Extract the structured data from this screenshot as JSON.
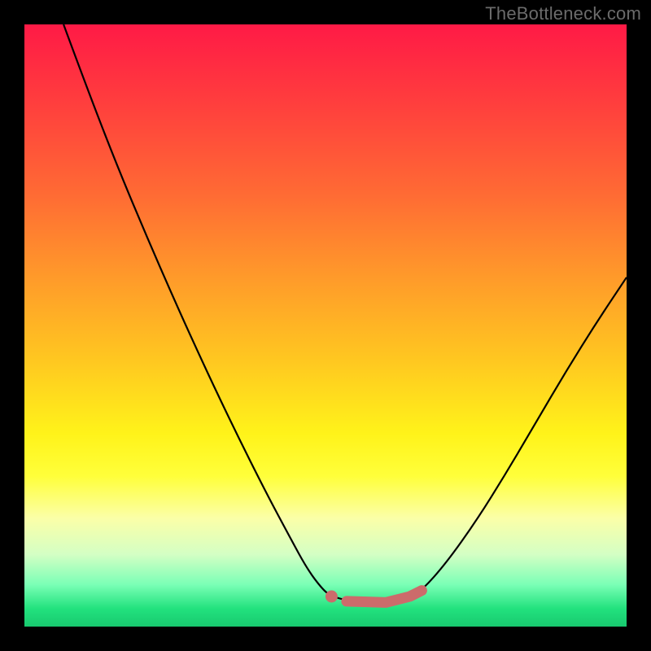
{
  "watermark": "TheBottleneck.com",
  "chart_data": {
    "type": "line",
    "title": "",
    "xlabel": "",
    "ylabel": "",
    "xlim": [
      0,
      1
    ],
    "ylim": [
      0,
      1
    ],
    "background_gradient": {
      "orientation": "vertical",
      "stops": [
        {
          "pos": 0.0,
          "color": "#ff1a46"
        },
        {
          "pos": 0.12,
          "color": "#ff3b3e"
        },
        {
          "pos": 0.28,
          "color": "#ff6a34"
        },
        {
          "pos": 0.42,
          "color": "#ff9a2a"
        },
        {
          "pos": 0.56,
          "color": "#ffc820"
        },
        {
          "pos": 0.68,
          "color": "#fff31a"
        },
        {
          "pos": 0.75,
          "color": "#ffff3a"
        },
        {
          "pos": 0.82,
          "color": "#fbffa8"
        },
        {
          "pos": 0.88,
          "color": "#d4ffc4"
        },
        {
          "pos": 0.93,
          "color": "#7bffb6"
        },
        {
          "pos": 0.97,
          "color": "#22e27e"
        },
        {
          "pos": 1.0,
          "color": "#18c96f"
        }
      ]
    },
    "series": [
      {
        "name": "curve",
        "color": "#000000",
        "points": [
          {
            "x": 0.065,
            "y": 1.0
          },
          {
            "x": 0.1,
            "y": 0.905
          },
          {
            "x": 0.15,
            "y": 0.775
          },
          {
            "x": 0.2,
            "y": 0.655
          },
          {
            "x": 0.25,
            "y": 0.54
          },
          {
            "x": 0.3,
            "y": 0.43
          },
          {
            "x": 0.35,
            "y": 0.325
          },
          {
            "x": 0.4,
            "y": 0.225
          },
          {
            "x": 0.44,
            "y": 0.15
          },
          {
            "x": 0.47,
            "y": 0.095
          },
          {
            "x": 0.495,
            "y": 0.062
          },
          {
            "x": 0.51,
            "y": 0.05
          },
          {
            "x": 0.55,
            "y": 0.04
          },
          {
            "x": 0.6,
            "y": 0.04
          },
          {
            "x": 0.64,
            "y": 0.05
          },
          {
            "x": 0.66,
            "y": 0.06
          },
          {
            "x": 0.7,
            "y": 0.105
          },
          {
            "x": 0.75,
            "y": 0.175
          },
          {
            "x": 0.8,
            "y": 0.255
          },
          {
            "x": 0.85,
            "y": 0.34
          },
          {
            "x": 0.9,
            "y": 0.425
          },
          {
            "x": 0.95,
            "y": 0.505
          },
          {
            "x": 1.0,
            "y": 0.58
          }
        ]
      }
    ],
    "highlight": {
      "color": "#cc6b6b",
      "dot": {
        "x": 0.51,
        "y": 0.05
      },
      "segment": [
        {
          "x": 0.535,
          "y": 0.042
        },
        {
          "x": 0.6,
          "y": 0.04
        },
        {
          "x": 0.64,
          "y": 0.05
        },
        {
          "x": 0.66,
          "y": 0.06
        }
      ]
    }
  }
}
